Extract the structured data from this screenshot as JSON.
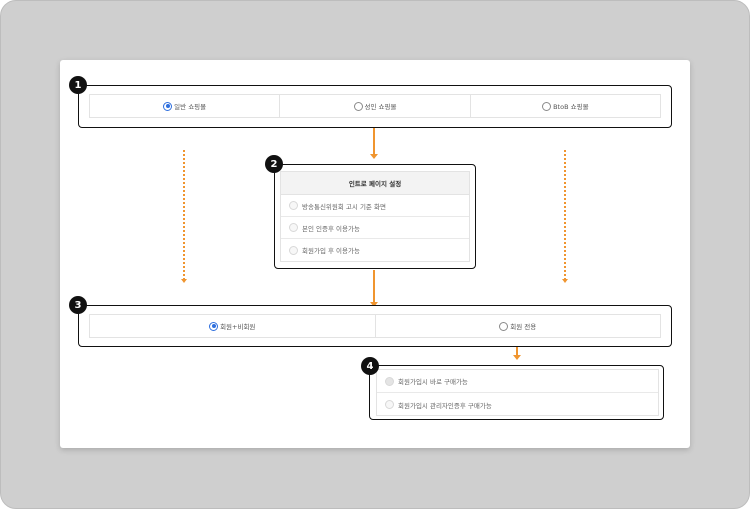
{
  "step1": {
    "badge": "1",
    "options": [
      {
        "label": "일반 쇼핑몰",
        "selected": true
      },
      {
        "label": "성인 쇼핑몰",
        "selected": false
      },
      {
        "label": "BtoB 쇼핑몰",
        "selected": false
      }
    ]
  },
  "step2": {
    "badge": "2",
    "title": "인트로 페이지 설정",
    "options": [
      {
        "label": "방송통신위원회 고시 기준 화면"
      },
      {
        "label": "본인 인증후 이용가능"
      },
      {
        "label": "회원가입 후 이용가능"
      }
    ]
  },
  "step3": {
    "badge": "3",
    "options": [
      {
        "label": "회원+비회원",
        "selected": true
      },
      {
        "label": "회원 전용",
        "selected": false
      }
    ]
  },
  "step4": {
    "badge": "4",
    "options": [
      {
        "label": "회원가입시 바로 구매가능"
      },
      {
        "label": "회원가입시 관리자인증후 구매가능"
      }
    ]
  },
  "colors": {
    "accent": "#f0952f",
    "radio_selected": "#2f6fde",
    "outer_background": "#cfcfcf"
  }
}
